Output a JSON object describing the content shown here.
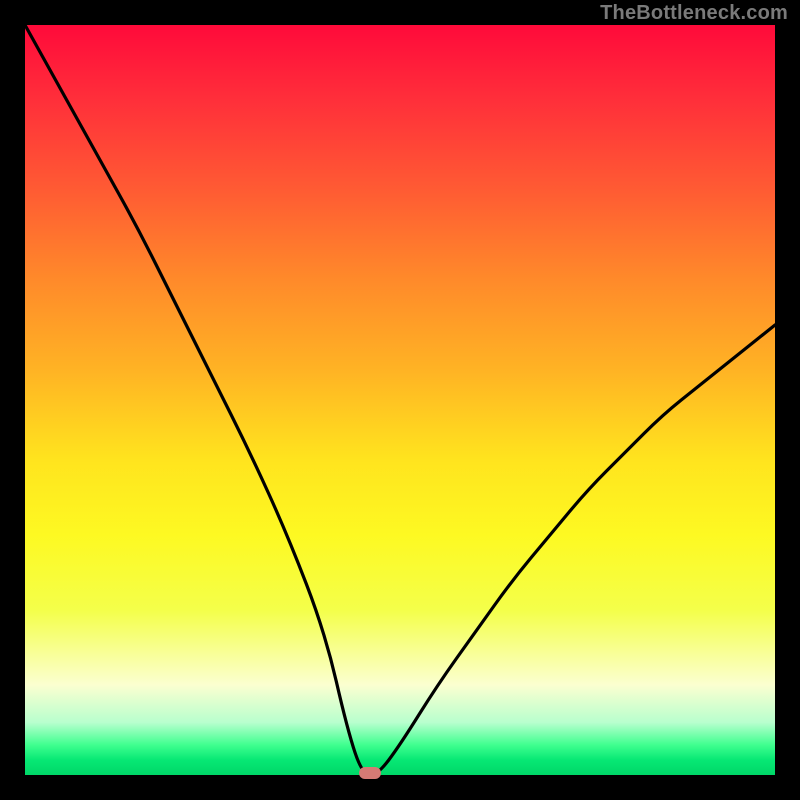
{
  "watermark": "TheBottleneck.com",
  "chart_data": {
    "type": "line",
    "title": "",
    "xlabel": "",
    "ylabel": "",
    "xlim": [
      0,
      100
    ],
    "ylim": [
      0,
      100
    ],
    "grid": false,
    "series": [
      {
        "name": "bottleneck-curve",
        "x": [
          0,
          5,
          10,
          15,
          20,
          25,
          30,
          35,
          40,
          43,
          45,
          47,
          50,
          55,
          60,
          65,
          70,
          75,
          80,
          85,
          90,
          95,
          100
        ],
        "values": [
          100,
          91,
          82,
          73,
          63,
          53,
          43,
          32,
          19,
          6,
          0,
          0,
          4,
          12,
          19,
          26,
          32,
          38,
          43,
          48,
          52,
          56,
          60
        ]
      }
    ],
    "annotations": [
      {
        "name": "minimum-marker",
        "x": 46,
        "y": 0,
        "shape": "pill",
        "color": "#d47a74"
      }
    ],
    "background_gradient": {
      "direction": "vertical",
      "stops": [
        {
          "pos": 0.0,
          "color": "#ff0a3a"
        },
        {
          "pos": 0.45,
          "color": "#ffb324"
        },
        {
          "pos": 0.7,
          "color": "#fdf922"
        },
        {
          "pos": 0.93,
          "color": "#b8ffce"
        },
        {
          "pos": 1.0,
          "color": "#00d768"
        }
      ]
    }
  }
}
